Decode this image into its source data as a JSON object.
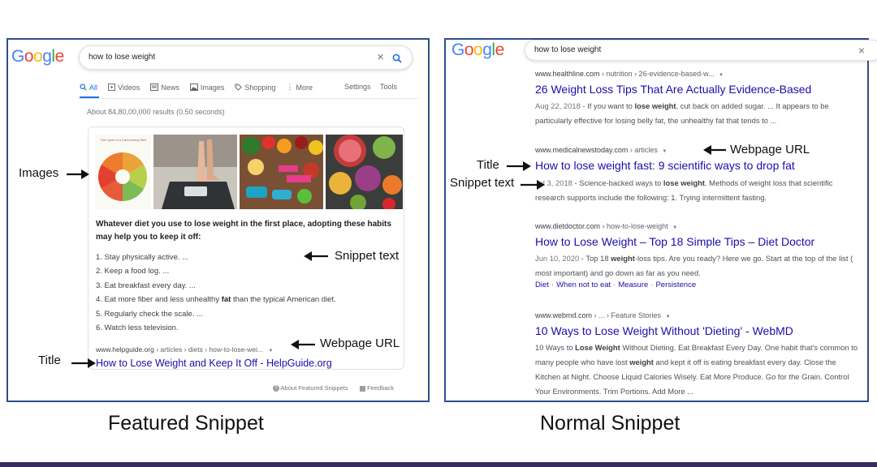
{
  "featured": {
    "logo": "Google",
    "search_query": "how to lose weight",
    "tabs": [
      {
        "label": "All",
        "icon": "search-icon",
        "active": true
      },
      {
        "label": "Videos",
        "icon": "video-icon"
      },
      {
        "label": "News",
        "icon": "news-icon"
      },
      {
        "label": "Images",
        "icon": "image-icon"
      },
      {
        "label": "Shopping",
        "icon": "tag-icon"
      },
      {
        "label": "More",
        "icon": "more-vert-icon"
      }
    ],
    "settings_label": "Settings",
    "tools_label": "Tools",
    "result_stats": "About 84,80,00,000 results (0.50 seconds)",
    "image_pie_title": "The Cycle of a Carb-Heavy Diet",
    "lead_parts": [
      "Whatever diet you use to ",
      "lose weight",
      " in the first place, adopting these habits may help you to keep it off:"
    ],
    "list": [
      {
        "text": "1. Stay physically active. ..."
      },
      {
        "text": "2. Keep a food log. ..."
      },
      {
        "text": "3. Eat breakfast every day. ..."
      },
      {
        "pre": "4. Eat more fiber and less unhealthy ",
        "bold": "fat",
        "post": " than the typical American diet."
      },
      {
        "text": "5. Regularly check the scale. ..."
      },
      {
        "text": "6. Watch less television."
      }
    ],
    "url": "www.helpguide.org",
    "url_crumbs": " › articles › diets › how-to-lose-wei...",
    "title": "How to Lose Weight and Keep It Off - HelpGuide.org",
    "footer_about": "About Featured Snippets",
    "footer_feedback": "Feedback",
    "annotations": {
      "images": "Images",
      "snippet_text": "Snippet text",
      "webpage_url": "Webpage URL",
      "title": "Title"
    },
    "caption": "Featured Snippet"
  },
  "normal": {
    "logo": "Google",
    "search_query": "how to lose weight",
    "results": [
      {
        "url": "www.healthline.com",
        "crumbs": " › nutrition › 26-evidence-based-w...",
        "title": "26 Weight Loss Tips That Are Actually Evidence-Based",
        "date": "Aug 22, 2018",
        "snippet_parts": [
          " - If you want to ",
          "lose weight",
          ", cut back on added sugar. ... It appears to be particularly effective for losing belly fat, the unhealthy fat that tends to ..."
        ]
      },
      {
        "url": "www.medicalnewstoday.com",
        "crumbs": " › articles",
        "title": "How to lose weight fast: 9 scientific ways to drop fat",
        "date": "Jul 3, 2018",
        "snippet_parts": [
          " - Science-backed ways to ",
          "lose weight",
          ". Methods of weight loss that scientific research supports include the following: 1. Trying intermittent fasting."
        ]
      },
      {
        "url": "www.dietdoctor.com",
        "crumbs": " › how-to-lose-weight",
        "title": "How to Lose Weight – Top 18 Simple Tips – Diet Doctor",
        "date": "Jun 10, 2020",
        "snippet_parts": [
          " - Top 18 ",
          "weight",
          "-loss tips. Are you ready? Here we go. Start at the top of the list ( most important) and go down as far as you need."
        ],
        "sitelinks": [
          "Diet",
          "When not to eat",
          "Measure",
          "Persistence"
        ]
      },
      {
        "url": "www.webmd.com",
        "crumbs": " › ... › Feature Stories",
        "title": "10 Ways to Lose Weight Without 'Dieting' - WebMD",
        "snippet_parts": [
          "10 Ways to ",
          "Lose Weight",
          " Without Dieting. Eat Breakfast Every Day. One habit that's common to many people who have lost ",
          "weight",
          " and kept it off is eating breakfast every day. Close the Kitchen at Night. Choose Liquid Calories Wisely. Eat More Produce. Go for the Grain. Control Your Environments. Trim Portions. Add More ..."
        ]
      }
    ],
    "annotations": {
      "title": "Title",
      "snippet_text": "Snippet text",
      "webpage_url": "Webpage URL"
    },
    "caption": "Normal Snippet"
  },
  "colors": {
    "frame": "#2e4f8a",
    "link": "#1a0dab",
    "accent": "#1a73e8"
  }
}
